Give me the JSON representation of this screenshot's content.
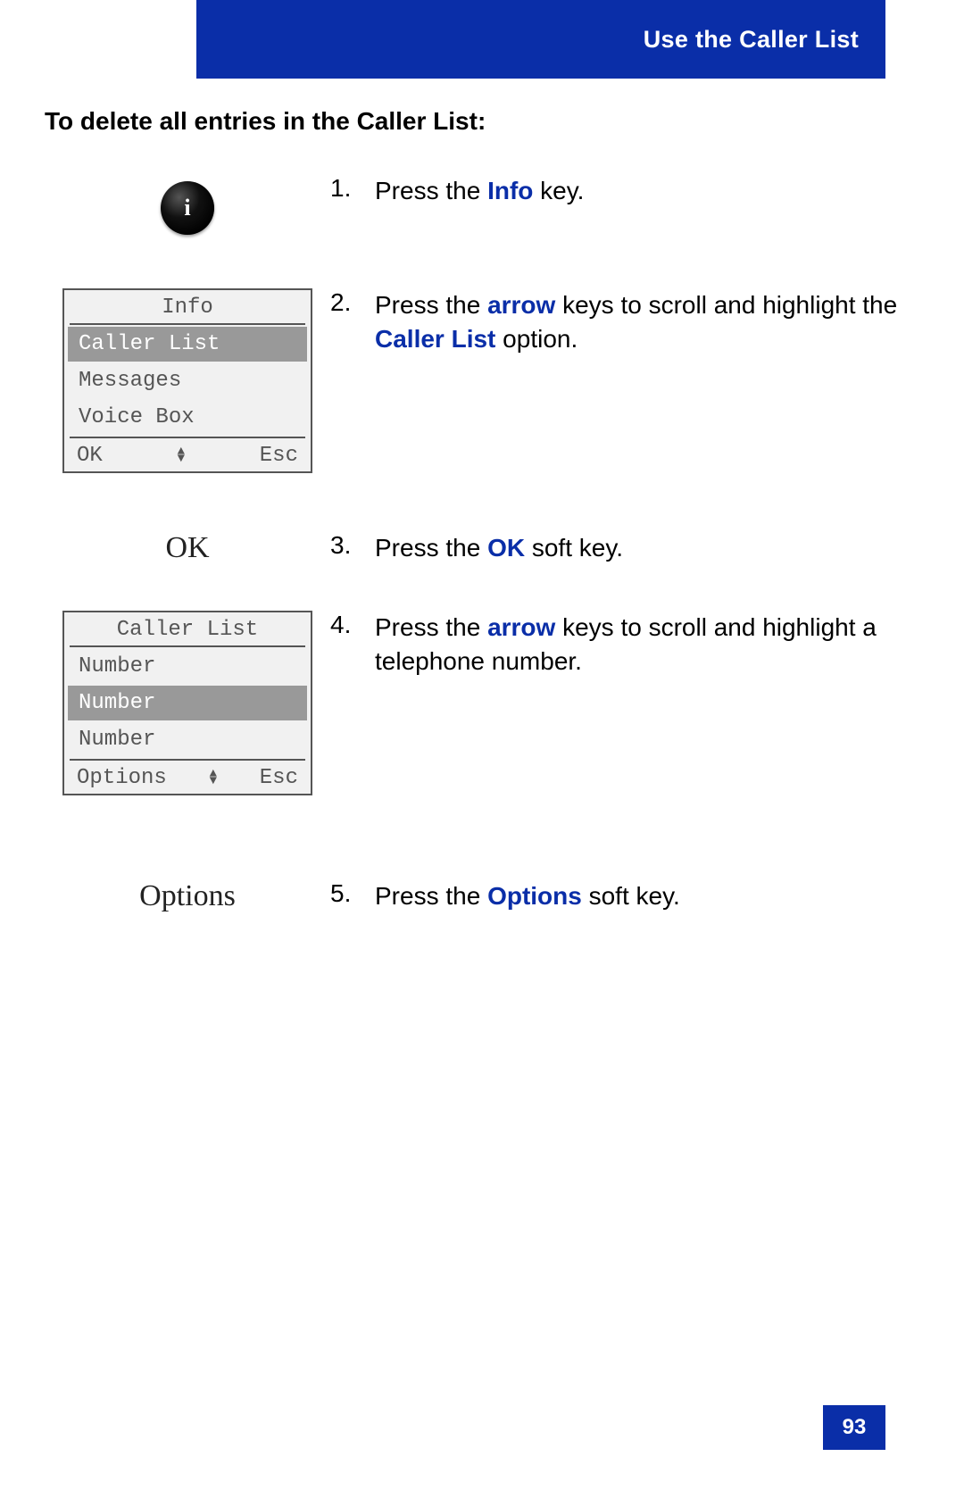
{
  "header": {
    "title": "Use the Caller List"
  },
  "section_title": "To delete all entries in the Caller List:",
  "steps": {
    "s1": {
      "num": "1.",
      "pre": "Press the ",
      "key": "Info",
      "post": " key."
    },
    "s2": {
      "num": "2.",
      "pre": "Press the ",
      "key1": "arrow",
      "mid": " keys to scroll and highlight the ",
      "key2": "Caller List",
      "post": " option."
    },
    "s3": {
      "num": "3.",
      "pre": "Press the ",
      "key": "OK",
      "post": " soft key."
    },
    "s4": {
      "num": "4.",
      "pre": "Press the ",
      "key1": "arrow",
      "post": " keys to scroll and highlight a telephone number."
    },
    "s5": {
      "num": "5.",
      "pre": "Press the ",
      "key": "Options",
      "post": " soft key."
    }
  },
  "info_key": {
    "glyph": "i"
  },
  "screen1": {
    "title": "Info",
    "items": [
      "Caller List",
      "Messages",
      "Voice Box"
    ],
    "selected_index": 0,
    "softkeys": {
      "left": "OK",
      "right": "Esc"
    }
  },
  "ok_label": "OK",
  "screen2": {
    "title": "Caller List",
    "items": [
      "Number",
      "Number",
      "Number"
    ],
    "selected_index": 1,
    "softkeys": {
      "left": "Options",
      "right": "Esc"
    }
  },
  "options_label": "Options",
  "page_number": "93"
}
